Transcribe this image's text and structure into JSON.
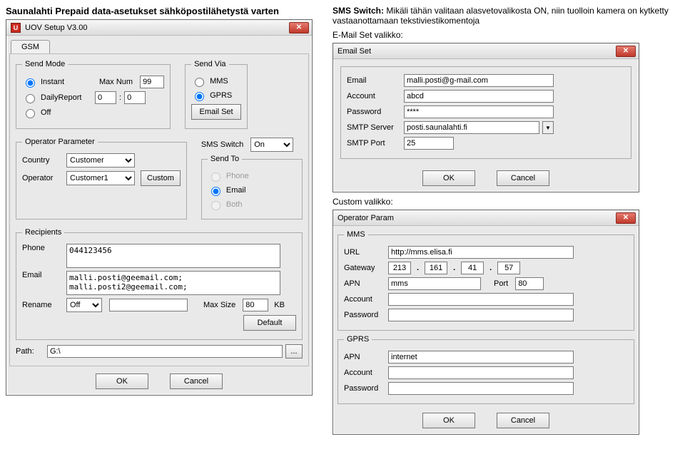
{
  "doc": {
    "left_heading": "Saunalahti Prepaid data-asetukset sähköpostilähetystä varten",
    "right_heading_prefix": "SMS Switch:",
    "right_heading_rest": " Mikäli tähän valitaan alasvetovalikosta ON, niin tuolloin kamera on kytketty vastaanottamaan tekstiviestikomentoja",
    "email_set_caption": "E-Mail Set valikko:",
    "custom_caption": "Custom valikko:"
  },
  "uov": {
    "title": "UOV Setup V3.00",
    "appicon_glyph": "U",
    "close_glyph": "✕",
    "tab_label": "GSM",
    "groups": {
      "send_mode": "Send Mode",
      "send_via": "Send Via",
      "operator_parameter": "Operator Parameter",
      "send_to": "Send To",
      "recipients": "Recipients"
    },
    "labels": {
      "instant": "Instant",
      "daily_report": "DailyReport",
      "off": "Off",
      "max_num": "Max Num",
      "mms": "MMS",
      "gprs": "GPRS",
      "email_set_btn": "Email Set",
      "country": "Country",
      "operator": "Operator",
      "custom_btn": "Custom",
      "sms_switch": "SMS Switch",
      "phone_opt": "Phone",
      "email_opt": "Email",
      "both_opt": "Both",
      "phone": "Phone",
      "email": "Email",
      "rename": "Rename",
      "max_size": "Max Size",
      "kb": "KB",
      "default_btn": "Default",
      "path": "Path:",
      "browse": "...",
      "ok": "OK",
      "cancel": "Cancel",
      "colon": ":"
    },
    "values": {
      "max_num": "99",
      "daily_h": "0",
      "daily_m": "0",
      "country": "Customer",
      "operator": "Customer1",
      "sms_switch": "On",
      "phone_recipients": "044123456",
      "email_recipients": "malli.posti@geemail.com;\nmalli.posti2@geemail.com;",
      "rename": "Off",
      "rename_text": "",
      "max_size": "80",
      "path": "G:\\"
    }
  },
  "emailset": {
    "title": "Email Set",
    "close_glyph": "✕",
    "labels": {
      "email": "Email",
      "account": "Account",
      "password": "Password",
      "smtp_server": "SMTP Server",
      "smtp_port": "SMTP Port",
      "ok": "OK",
      "cancel": "Cancel"
    },
    "values": {
      "email": "malli.posti@g-mail.com",
      "account": "abcd",
      "password": "****",
      "smtp_server": "posti.saunalahti.fi",
      "smtp_port": "25"
    }
  },
  "custom": {
    "title": "Operator Param",
    "close_glyph": "✕",
    "groups": {
      "mms": "MMS",
      "gprs": "GPRS"
    },
    "labels": {
      "url": "URL",
      "gateway": "Gateway",
      "apn": "APN",
      "port": "Port",
      "account": "Account",
      "password": "Password",
      "ok": "OK",
      "cancel": "Cancel"
    },
    "values": {
      "url": "http://mms.elisa.fi",
      "gateway": [
        "213",
        "161",
        "41",
        "57"
      ],
      "mms_apn": "mms",
      "mms_port": "80",
      "mms_account": "",
      "mms_password": "",
      "gprs_apn": "internet",
      "gprs_account": "",
      "gprs_password": ""
    }
  }
}
